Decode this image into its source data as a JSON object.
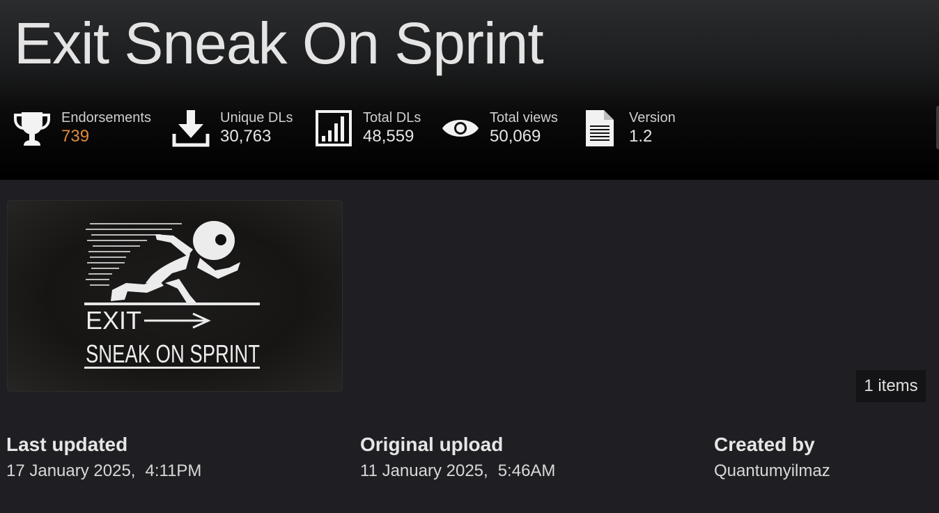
{
  "mod": {
    "title": "Exit Sneak On Sprint"
  },
  "stats": [
    {
      "label": "Endorsements",
      "value": "739",
      "icon": "trophy-icon"
    },
    {
      "label": "Unique DLs",
      "value": "30,763",
      "icon": "download-icon"
    },
    {
      "label": "Total DLs",
      "value": "48,559",
      "icon": "bar-chart-icon"
    },
    {
      "label": "Total views",
      "value": "50,069",
      "icon": "eye-icon"
    },
    {
      "label": "Version",
      "value": "1.2",
      "icon": "document-icon"
    }
  ],
  "gallery": {
    "items_count": "1 items",
    "image_text_line1": "EXIT",
    "image_text_line2": "SNEAK ON SPRINT"
  },
  "meta": {
    "last_updated": {
      "label": "Last updated",
      "date": "17 January 2025,",
      "time": "4:11PM"
    },
    "original_upload": {
      "label": "Original upload",
      "date": "11 January 2025,",
      "time": "5:46AM"
    },
    "created_by": {
      "label": "Created by",
      "value": "Quantumyilmaz"
    }
  },
  "colors": {
    "accent": "#e08a3a",
    "background": "#1f1f23",
    "text": "#e6e6e6"
  }
}
